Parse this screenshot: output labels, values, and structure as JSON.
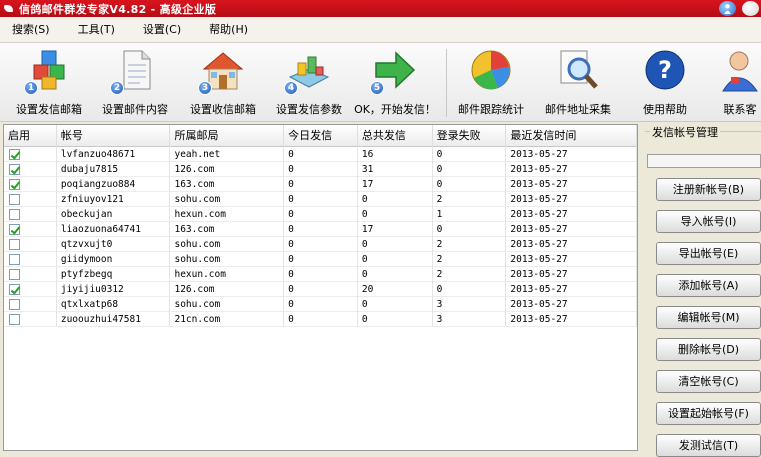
{
  "window": {
    "title": "信鸽邮件群发专家V4.82 - 高级企业版"
  },
  "menu": [
    "搜索(S)",
    "工具(T)",
    "设置(C)",
    "帮助(H)"
  ],
  "toolbar": [
    {
      "label": "设置发信邮箱",
      "num": "1",
      "icon": "cubes-icon"
    },
    {
      "label": "设置邮件内容",
      "num": "2",
      "icon": "document-icon"
    },
    {
      "label": "设置收信邮箱",
      "num": "3",
      "icon": "house-icon"
    },
    {
      "label": "设置发信参数",
      "num": "4",
      "icon": "blocks-icon"
    },
    {
      "label": "OK，开始发信！",
      "num": "5",
      "icon": "arrow-right-icon"
    },
    {
      "label": "邮件跟踪统计",
      "num": "",
      "icon": "pie-chart-icon"
    },
    {
      "label": "邮件地址采集",
      "num": "",
      "icon": "magnifier-icon"
    },
    {
      "label": "使用帮助",
      "num": "",
      "icon": "help-icon"
    },
    {
      "label": "联系客",
      "num": "",
      "icon": "user-icon"
    }
  ],
  "table": {
    "headers": [
      "启用",
      "帐号",
      "所属邮局",
      "今日发信",
      "总共发信",
      "登录失败",
      "最近发信时间"
    ],
    "rows": [
      {
        "enabled": true,
        "account": "lvfanzuo48671",
        "server": "yeah.net",
        "today": "0",
        "total": "16",
        "fail": "0",
        "last": "2013-05-27"
      },
      {
        "enabled": true,
        "account": "dubaju7815",
        "server": "126.com",
        "today": "0",
        "total": "31",
        "fail": "0",
        "last": "2013-05-27"
      },
      {
        "enabled": true,
        "account": "poqiangzuo884",
        "server": "163.com",
        "today": "0",
        "total": "17",
        "fail": "0",
        "last": "2013-05-27"
      },
      {
        "enabled": false,
        "account": "zfniuyov121",
        "server": "sohu.com",
        "today": "0",
        "total": "0",
        "fail": "2",
        "last": "2013-05-27"
      },
      {
        "enabled": false,
        "account": "obeckujan",
        "server": "hexun.com",
        "today": "0",
        "total": "0",
        "fail": "1",
        "last": "2013-05-27"
      },
      {
        "enabled": true,
        "account": "liaozuona64741",
        "server": "163.com",
        "today": "0",
        "total": "17",
        "fail": "0",
        "last": "2013-05-27"
      },
      {
        "enabled": false,
        "account": "qtzvxujt0",
        "server": "sohu.com",
        "today": "0",
        "total": "0",
        "fail": "2",
        "last": "2013-05-27"
      },
      {
        "enabled": false,
        "account": "giidymoon",
        "server": "sohu.com",
        "today": "0",
        "total": "0",
        "fail": "2",
        "last": "2013-05-27"
      },
      {
        "enabled": false,
        "account": "ptyfzbegq",
        "server": "hexun.com",
        "today": "0",
        "total": "0",
        "fail": "2",
        "last": "2013-05-27"
      },
      {
        "enabled": true,
        "account": "jiyijiu0312",
        "server": "126.com",
        "today": "0",
        "total": "20",
        "fail": "0",
        "last": "2013-05-27"
      },
      {
        "enabled": false,
        "account": "qtxlxatp68",
        "server": "sohu.com",
        "today": "0",
        "total": "0",
        "fail": "3",
        "last": "2013-05-27"
      },
      {
        "enabled": false,
        "account": "zuoouzhui47581",
        "server": "21cn.com",
        "today": "0",
        "total": "0",
        "fail": "3",
        "last": "2013-05-27"
      }
    ]
  },
  "side": {
    "group_title": "发信帐号管理",
    "buttons": [
      "注册新帐号(B)",
      "导入帐号(I)",
      "导出帐号(E)",
      "添加帐号(A)",
      "编辑帐号(M)",
      "删除帐号(D)",
      "清空帐号(C)",
      "设置起始帐号(F)",
      "发测试信(T)"
    ]
  },
  "colors": {
    "title_bar": "#c8101a",
    "window_bg": "#ece9d8",
    "check": "#21a121"
  }
}
